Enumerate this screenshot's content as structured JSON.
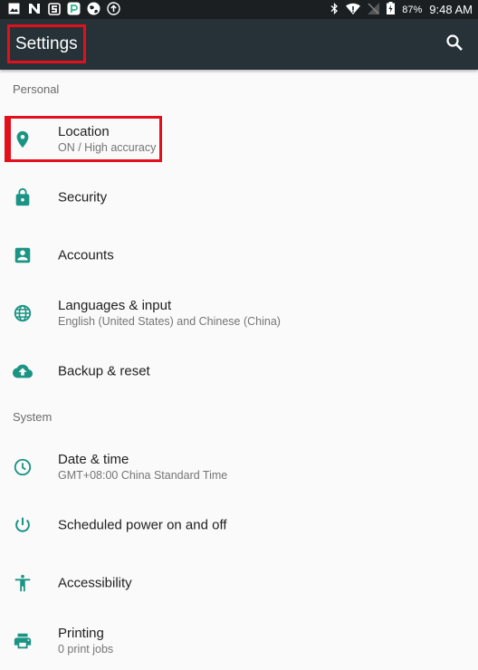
{
  "statusbar": {
    "notification_icons": [
      "image-icon",
      "n-app-icon",
      "s-app-icon",
      "p-app-icon",
      "globe-app-icon",
      "upload-icon"
    ],
    "battery_percent": "87%",
    "time": "9:48 AM"
  },
  "appbar": {
    "title": "Settings"
  },
  "sections": {
    "personal": "Personal",
    "system": "System"
  },
  "items": [
    {
      "label": "Location",
      "sub": "ON / High accuracy"
    },
    {
      "label": "Security"
    },
    {
      "label": "Accounts"
    },
    {
      "label": "Languages & input",
      "sub": "English (United States) and Chinese (China)"
    },
    {
      "label": "Backup & reset"
    },
    {
      "label": "Date & time",
      "sub": "GMT+08:00 China Standard Time"
    },
    {
      "label": "Scheduled power on and off"
    },
    {
      "label": "Accessibility"
    },
    {
      "label": "Printing",
      "sub": "0 print jobs"
    }
  ],
  "colors": {
    "accent": "#1a9484",
    "appbar": "#263238",
    "highlight": "#e3101b"
  }
}
